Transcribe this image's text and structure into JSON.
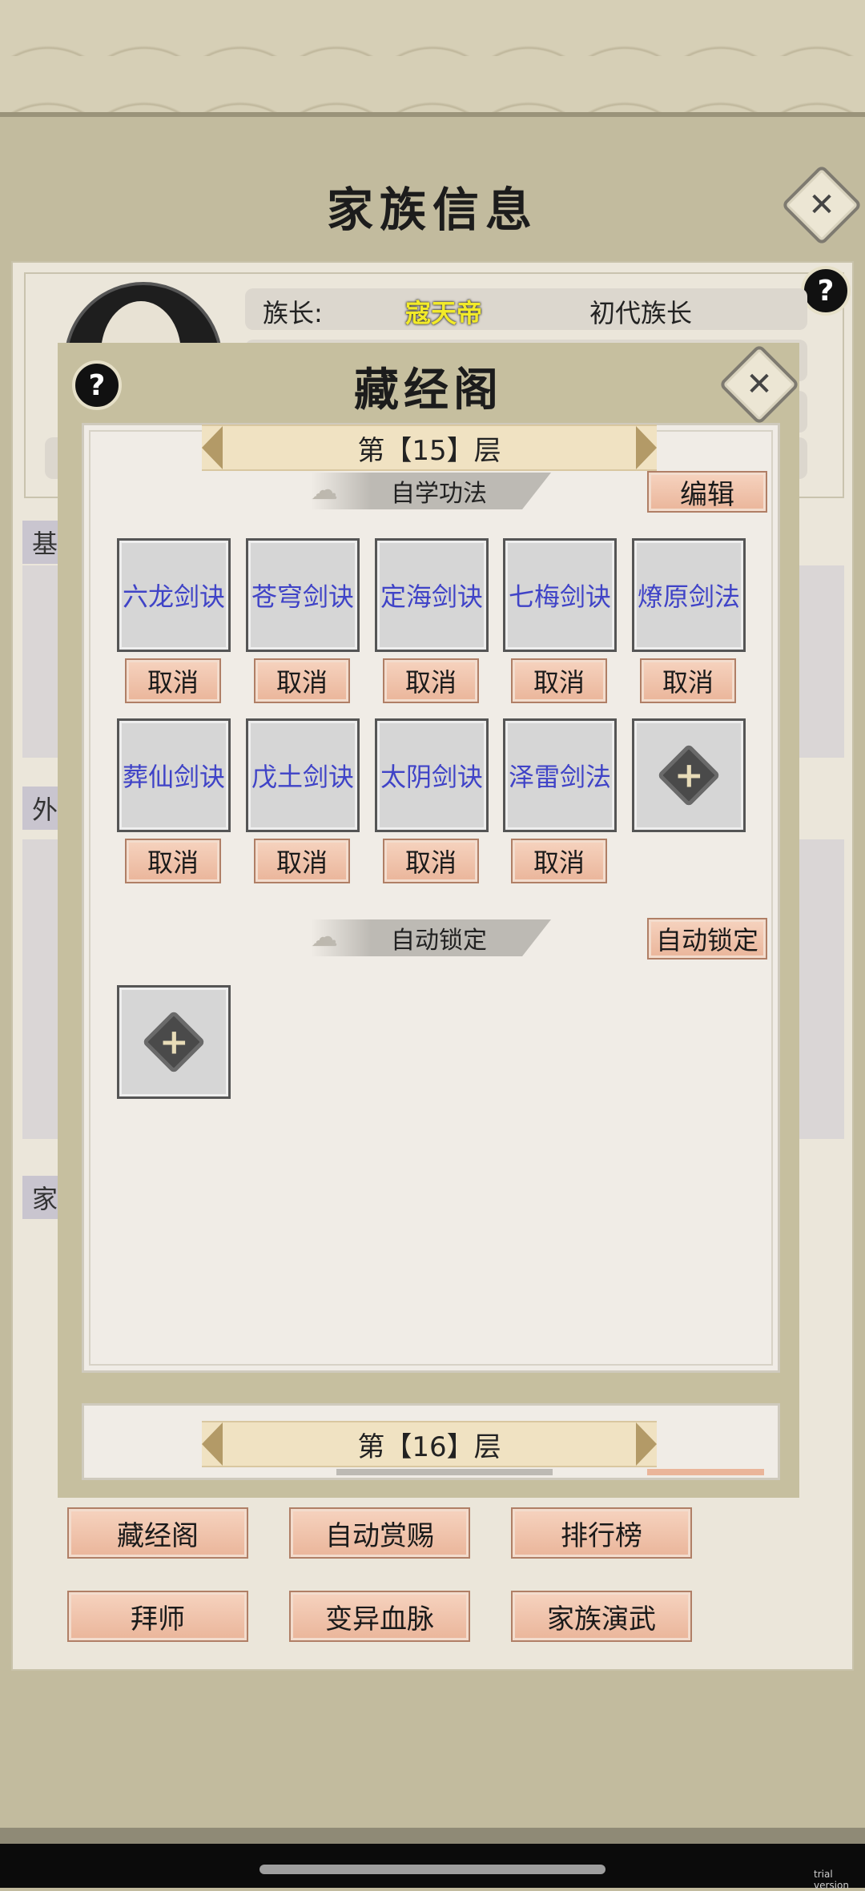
{
  "screen": {
    "title": "家族信息",
    "trial_label": "trial version"
  },
  "family": {
    "leader_label": "族长:",
    "leader_name": "寇天帝",
    "leader_title": "初代族长",
    "side_tabs": [
      "基",
      "外",
      "家"
    ],
    "buttons_row1": [
      "藏经阁",
      "自动赏赐",
      "排行榜"
    ],
    "buttons_row2": [
      "拜师",
      "变异血脉",
      "家族演武"
    ]
  },
  "modal": {
    "title": "藏经阁",
    "floor15": {
      "label": "第【15】层",
      "section_self_study": "自学功法",
      "edit_button": "编辑",
      "skills": [
        "六龙剑诀",
        "苍穹剑诀",
        "定海剑诀",
        "七梅剑诀",
        "燎原剑法",
        "葬仙剑诀",
        "戊土剑诀",
        "太阴剑诀",
        "泽雷剑法"
      ],
      "cancel_label": "取消",
      "section_auto_lock": "自动锁定",
      "auto_lock_button": "自动锁定"
    },
    "floor16": {
      "label": "第【16】层"
    }
  }
}
